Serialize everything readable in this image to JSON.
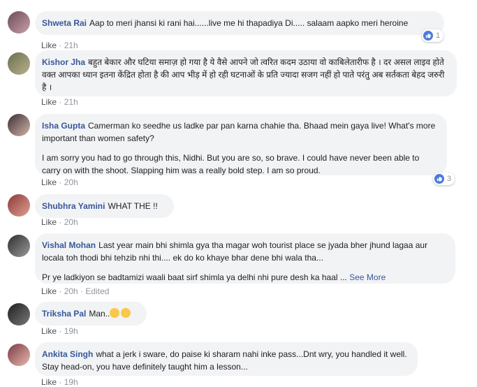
{
  "comments": [
    {
      "author": "Shweta Rai",
      "text": "Aap to meri jhansi ki rani hai......live me hi thapadiya Di..... salaam aapko meri heroine",
      "like": "Like",
      "time": "21h",
      "reactions": "1"
    },
    {
      "author": "Kishor Jha",
      "text": "बहुत बेकार और घटिया समाज़ हो गया है ये वैसे आपने जो त्वरित कदम उठाया वो काबिलेतारीफ है । दर असल लाइव होते वक्त आपका ध्यान इतना केंद्रित होता है की आप भीड़ में हो रही घटनाओं के प्रति ज्यादा सजग नहीं हो पाते परंतु अब सर्तकता बेहद जरुरी है ।",
      "like": "Like",
      "time": "21h"
    },
    {
      "author": "Isha Gupta",
      "text": "Camerman ko seedhe us ladke par pan karna chahie tha. Bhaad mein gaya live! What's more important than women safety?",
      "text2": "I am sorry you had to go through this, Nidhi. But you are so, so brave. I could have never been able to carry on with the shoot. Slapping him was a really bold step. I am so proud.",
      "like": "Like",
      "time": "20h",
      "reactions": "3"
    },
    {
      "author": "Shubhra Yamini",
      "text": "WHAT THE !!",
      "like": "Like",
      "time": "20h"
    },
    {
      "author": "Vishal Mohan",
      "text": "Last year main bhi shimla gya tha magar woh tourist place se jyada bher jhund lagaa aur locala toh thodi bhi tehzib nhi thi.... ek do ko khaye bhar dene bhi wala tha...",
      "text2": "Pr ye ladkiyon se badtamizi waali baat sirf shimla ya delhi nhi pure desh ka haal ...",
      "see_more": "See More",
      "like": "Like",
      "time": "20h",
      "edited": "Edited"
    },
    {
      "author": "Triksha Pal",
      "text": "Man..",
      "like": "Like",
      "time": "19h"
    },
    {
      "author": "Ankita Singh",
      "text": "what a jerk i sware, do paise ki sharam nahi inke pass...Dnt wry, you handled it well. Stay head-on, you have definitely taught him a lesson...",
      "like": "Like",
      "time": "19h"
    }
  ],
  "dot": "·",
  "colors": {
    "author": "#365899",
    "bubble": "#f2f3f5",
    "meta": "#90949c",
    "like_badge": "#4a7bdd"
  }
}
